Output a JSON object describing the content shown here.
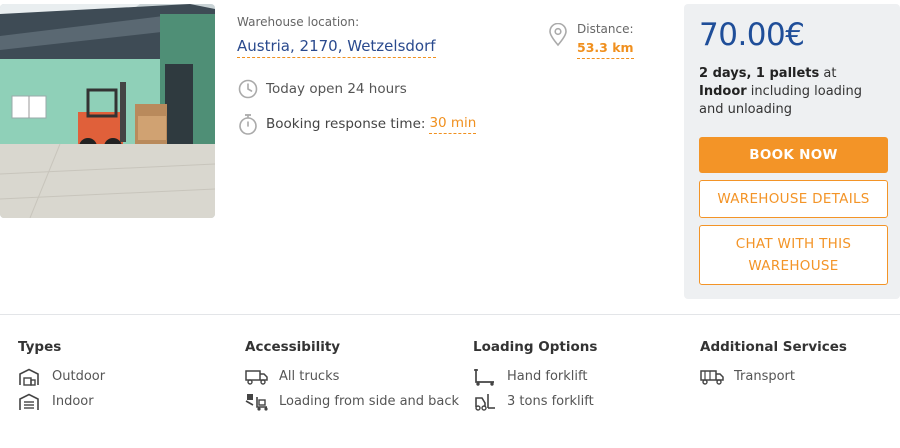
{
  "location": {
    "label": "Warehouse location:",
    "value": "Austria, 2170, Wetzelsdorf"
  },
  "distance": {
    "label": "Distance:",
    "value": "53.3 km"
  },
  "hours": {
    "text": "Today open 24 hours"
  },
  "response": {
    "label": "Booking response time:",
    "value": "30 min"
  },
  "panel": {
    "price": "70.00€",
    "desc_bold_1": "2 days, 1 pallets",
    "desc_mid": " at ",
    "desc_bold_2": "Indoor",
    "desc_rest": " including loading and unloading",
    "book_label": "BOOK NOW",
    "details_label": "WAREHOUSE DETAILS",
    "chat_label": "CHAT WITH THIS WAREHOUSE"
  },
  "features": {
    "types": {
      "title": "Types",
      "items": [
        {
          "label": "Outdoor",
          "icon": "outdoor-warehouse-icon"
        },
        {
          "label": "Indoor",
          "icon": "indoor-warehouse-icon"
        }
      ]
    },
    "accessibility": {
      "title": "Accessibility",
      "items": [
        {
          "label": "All trucks",
          "icon": "truck-icon"
        },
        {
          "label": "Loading from side and back",
          "icon": "side-loading-icon"
        }
      ]
    },
    "loading": {
      "title": "Loading Options",
      "items": [
        {
          "label": "Hand forklift",
          "icon": "hand-forklift-icon"
        },
        {
          "label": "3 tons forklift",
          "icon": "forklift-icon"
        }
      ]
    },
    "services": {
      "title": "Additional Services",
      "items": [
        {
          "label": "Transport",
          "icon": "transport-truck-icon"
        }
      ]
    }
  },
  "colors": {
    "accent": "#f39427",
    "price_blue": "#1f4e99",
    "link_blue": "#2a4a8e",
    "panel_bg": "#eef0f2"
  }
}
